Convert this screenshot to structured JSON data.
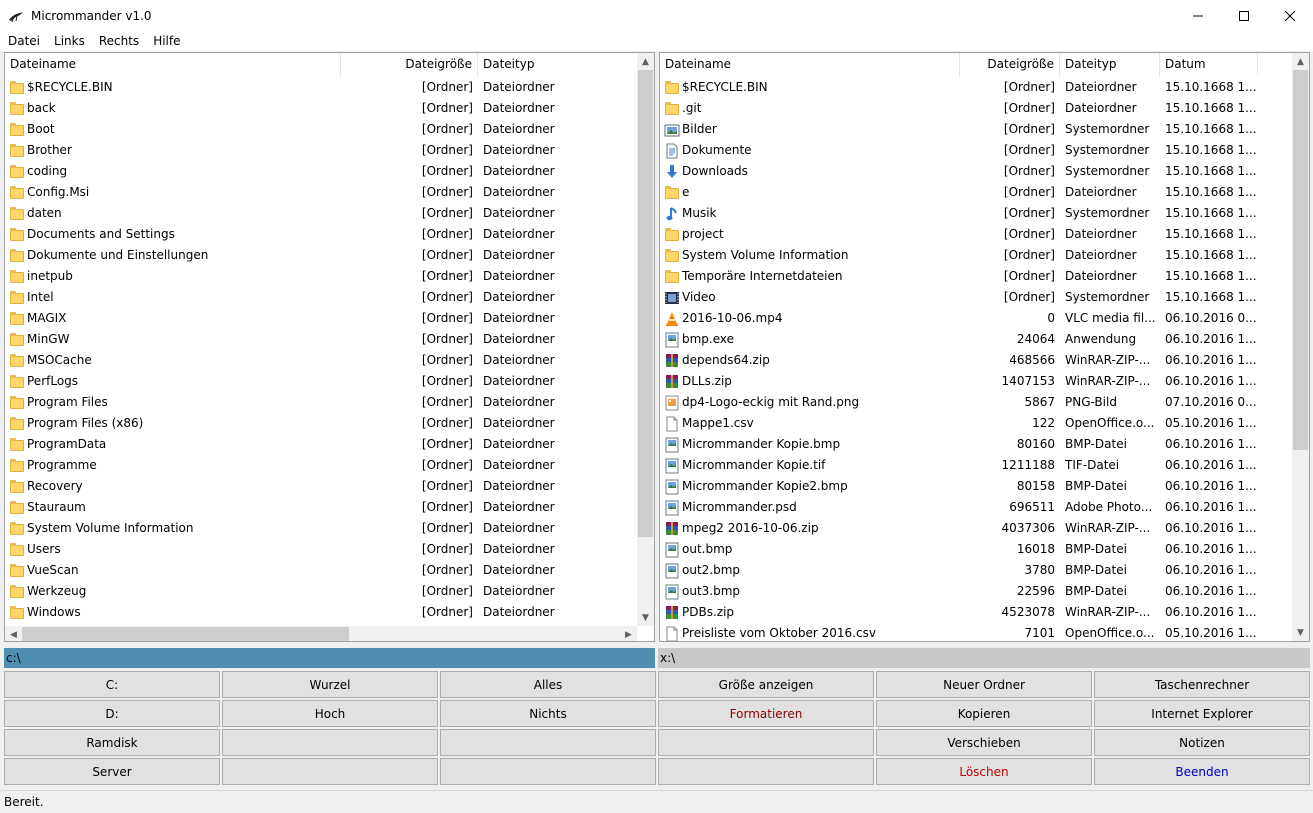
{
  "window": {
    "title": "Micrommander v1.0"
  },
  "menu": [
    "Datei",
    "Links",
    "Rechts",
    "Hilfe"
  ],
  "left": {
    "columns": [
      "Dateiname",
      "Dateigröße",
      "Dateityp"
    ],
    "path": "c:\\",
    "rows": [
      {
        "icon": "folder",
        "name": "$RECYCLE.BIN",
        "size": "[Ordner]",
        "type": "Dateiordner"
      },
      {
        "icon": "folder",
        "name": "back",
        "size": "[Ordner]",
        "type": "Dateiordner"
      },
      {
        "icon": "folder",
        "name": "Boot",
        "size": "[Ordner]",
        "type": "Dateiordner"
      },
      {
        "icon": "folder",
        "name": "Brother",
        "size": "[Ordner]",
        "type": "Dateiordner"
      },
      {
        "icon": "folder",
        "name": "coding",
        "size": "[Ordner]",
        "type": "Dateiordner"
      },
      {
        "icon": "folder",
        "name": "Config.Msi",
        "size": "[Ordner]",
        "type": "Dateiordner"
      },
      {
        "icon": "folder",
        "name": "daten",
        "size": "[Ordner]",
        "type": "Dateiordner"
      },
      {
        "icon": "folder",
        "name": "Documents and Settings",
        "size": "[Ordner]",
        "type": "Dateiordner"
      },
      {
        "icon": "folder",
        "name": "Dokumente und Einstellungen",
        "size": "[Ordner]",
        "type": "Dateiordner"
      },
      {
        "icon": "folder",
        "name": "inetpub",
        "size": "[Ordner]",
        "type": "Dateiordner"
      },
      {
        "icon": "folder",
        "name": "Intel",
        "size": "[Ordner]",
        "type": "Dateiordner"
      },
      {
        "icon": "folder",
        "name": "MAGIX",
        "size": "[Ordner]",
        "type": "Dateiordner"
      },
      {
        "icon": "folder",
        "name": "MinGW",
        "size": "[Ordner]",
        "type": "Dateiordner"
      },
      {
        "icon": "folder",
        "name": "MSOCache",
        "size": "[Ordner]",
        "type": "Dateiordner"
      },
      {
        "icon": "folder",
        "name": "PerfLogs",
        "size": "[Ordner]",
        "type": "Dateiordner"
      },
      {
        "icon": "folder",
        "name": "Program Files",
        "size": "[Ordner]",
        "type": "Dateiordner"
      },
      {
        "icon": "folder",
        "name": "Program Files (x86)",
        "size": "[Ordner]",
        "type": "Dateiordner"
      },
      {
        "icon": "folder",
        "name": "ProgramData",
        "size": "[Ordner]",
        "type": "Dateiordner"
      },
      {
        "icon": "folder",
        "name": "Programme",
        "size": "[Ordner]",
        "type": "Dateiordner"
      },
      {
        "icon": "folder",
        "name": "Recovery",
        "size": "[Ordner]",
        "type": "Dateiordner"
      },
      {
        "icon": "folder",
        "name": "Stauraum",
        "size": "[Ordner]",
        "type": "Dateiordner"
      },
      {
        "icon": "folder",
        "name": "System Volume Information",
        "size": "[Ordner]",
        "type": "Dateiordner"
      },
      {
        "icon": "folder",
        "name": "Users",
        "size": "[Ordner]",
        "type": "Dateiordner"
      },
      {
        "icon": "folder",
        "name": "VueScan",
        "size": "[Ordner]",
        "type": "Dateiordner"
      },
      {
        "icon": "folder",
        "name": "Werkzeug",
        "size": "[Ordner]",
        "type": "Dateiordner"
      },
      {
        "icon": "folder",
        "name": "Windows",
        "size": "[Ordner]",
        "type": "Dateiordner"
      }
    ]
  },
  "right": {
    "columns": [
      "Dateiname",
      "Dateigröße",
      "Dateityp",
      "Datum"
    ],
    "path": "x:\\",
    "rows": [
      {
        "icon": "folder",
        "name": "$RECYCLE.BIN",
        "size": "[Ordner]",
        "type": "Dateiordner",
        "date": "15.10.1668 1..."
      },
      {
        "icon": "folder",
        "name": ".git",
        "size": "[Ordner]",
        "type": "Dateiordner",
        "date": "15.10.1668 1..."
      },
      {
        "icon": "pictures",
        "name": "Bilder",
        "size": "[Ordner]",
        "type": "Systemordner",
        "date": "15.10.1668 1..."
      },
      {
        "icon": "documents",
        "name": "Dokumente",
        "size": "[Ordner]",
        "type": "Systemordner",
        "date": "15.10.1668 1..."
      },
      {
        "icon": "download",
        "name": "Downloads",
        "size": "[Ordner]",
        "type": "Systemordner",
        "date": "15.10.1668 1..."
      },
      {
        "icon": "folder",
        "name": "e",
        "size": "[Ordner]",
        "type": "Dateiordner",
        "date": "15.10.1668 1..."
      },
      {
        "icon": "music",
        "name": "Musik",
        "size": "[Ordner]",
        "type": "Systemordner",
        "date": "15.10.1668 1..."
      },
      {
        "icon": "folder",
        "name": "project",
        "size": "[Ordner]",
        "type": "Dateiordner",
        "date": "15.10.1668 1..."
      },
      {
        "icon": "folder",
        "name": "System Volume Information",
        "size": "[Ordner]",
        "type": "Dateiordner",
        "date": "15.10.1668 1..."
      },
      {
        "icon": "folder",
        "name": "Temporäre Internetdateien",
        "size": "[Ordner]",
        "type": "Dateiordner",
        "date": "15.10.1668 1..."
      },
      {
        "icon": "video",
        "name": "Video",
        "size": "[Ordner]",
        "type": "Systemordner",
        "date": "15.10.1668 1..."
      },
      {
        "icon": "vlc",
        "name": "2016-10-06.mp4",
        "size": "0",
        "type": "VLC media fil...",
        "date": "06.10.2016 0..."
      },
      {
        "icon": "image-file",
        "name": "bmp.exe",
        "size": "24064",
        "type": "Anwendung",
        "date": "06.10.2016 1..."
      },
      {
        "icon": "winrar",
        "name": "depends64.zip",
        "size": "468566",
        "type": "WinRAR-ZIP-...",
        "date": "06.10.2016 1..."
      },
      {
        "icon": "winrar",
        "name": "DLLs.zip",
        "size": "1407153",
        "type": "WinRAR-ZIP-...",
        "date": "06.10.2016 1..."
      },
      {
        "icon": "png",
        "name": "dp4-Logo-eckig mit Rand.png",
        "size": "5867",
        "type": "PNG-Bild",
        "date": "07.10.2016 0..."
      },
      {
        "icon": "blank-file",
        "name": "Mappe1.csv",
        "size": "122",
        "type": "OpenOffice.o...",
        "date": "05.10.2016 1..."
      },
      {
        "icon": "image-file",
        "name": "Micrommander Kopie.bmp",
        "size": "80160",
        "type": "BMP-Datei",
        "date": "06.10.2016 1..."
      },
      {
        "icon": "image-file",
        "name": "Micrommander Kopie.tif",
        "size": "1211188",
        "type": "TIF-Datei",
        "date": "06.10.2016 1..."
      },
      {
        "icon": "image-file",
        "name": "Micrommander Kopie2.bmp",
        "size": "80158",
        "type": "BMP-Datei",
        "date": "06.10.2016 1..."
      },
      {
        "icon": "image-file",
        "name": "Micrommander.psd",
        "size": "696511",
        "type": "Adobe Photo...",
        "date": "06.10.2016 1..."
      },
      {
        "icon": "winrar",
        "name": "mpeg2 2016-10-06.zip",
        "size": "4037306",
        "type": "WinRAR-ZIP-...",
        "date": "06.10.2016 1..."
      },
      {
        "icon": "image-file",
        "name": "out.bmp",
        "size": "16018",
        "type": "BMP-Datei",
        "date": "06.10.2016 1..."
      },
      {
        "icon": "image-file",
        "name": "out2.bmp",
        "size": "3780",
        "type": "BMP-Datei",
        "date": "06.10.2016 1..."
      },
      {
        "icon": "image-file",
        "name": "out3.bmp",
        "size": "22596",
        "type": "BMP-Datei",
        "date": "06.10.2016 1..."
      },
      {
        "icon": "winrar",
        "name": "PDBs.zip",
        "size": "4523078",
        "type": "WinRAR-ZIP-...",
        "date": "06.10.2016 1..."
      },
      {
        "icon": "blank-file",
        "name": "Preisliste  vom Oktober 2016.csv",
        "size": "7101",
        "type": "OpenOffice.o...",
        "date": "05.10.2016 1..."
      }
    ]
  },
  "buttons": [
    [
      "C:",
      "Wurzel",
      "Alles",
      "Größe anzeigen",
      "Neuer Ordner",
      "Taschenrechner"
    ],
    [
      "D:",
      "Hoch",
      "Nichts",
      "Formatieren",
      "Kopieren",
      "Internet Explorer"
    ],
    [
      "Ramdisk",
      "",
      "",
      "",
      "Verschieben",
      "Notizen"
    ],
    [
      "Server",
      "",
      "",
      "",
      "Löschen",
      "Beenden"
    ]
  ],
  "button_colors": {
    "Formatieren": "#8b0000",
    "Löschen": "#c00000",
    "Beenden": "#0000c0"
  },
  "status": "Bereit."
}
